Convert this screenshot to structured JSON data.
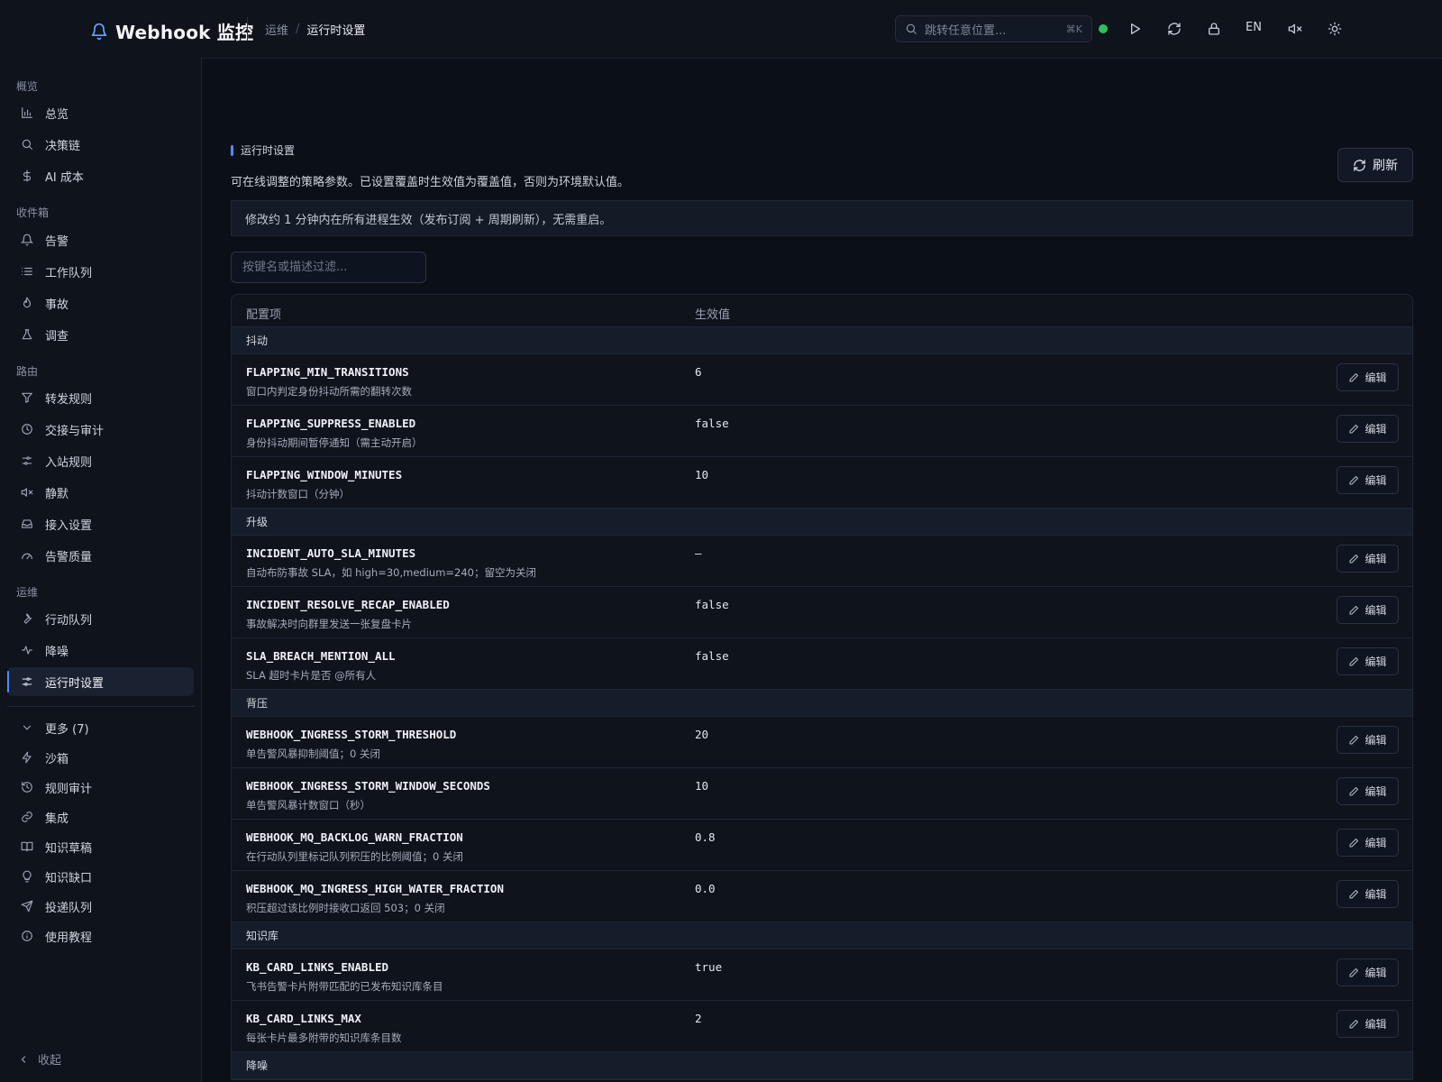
{
  "header": {
    "brand": "Webhook 监控",
    "breadcrumb_parent": "运维",
    "breadcrumb_sep": "/",
    "breadcrumb_current": "运行时设置",
    "search_placeholder": "跳转任意位置...",
    "search_shortcut": "⌘K",
    "lang": "EN",
    "status_color": "#2fbf5a"
  },
  "sidebar": {
    "groups": [
      "概览",
      "收件箱",
      "路由",
      "运维"
    ],
    "items": [
      {
        "label": "总览",
        "icon": "bar-chart-icon"
      },
      {
        "label": "决策链",
        "icon": "search-icon"
      },
      {
        "label": "AI 成本",
        "icon": "dollar-icon"
      },
      {
        "label": "告警",
        "icon": "bell-icon"
      },
      {
        "label": "工作队列",
        "icon": "list-icon"
      },
      {
        "label": "事故",
        "icon": "flame-icon"
      },
      {
        "label": "调查",
        "icon": "flask-icon"
      },
      {
        "label": "转发规则",
        "icon": "filter-icon"
      },
      {
        "label": "交接与审计",
        "icon": "clock-icon"
      },
      {
        "label": "入站规则",
        "icon": "sliders-icon"
      },
      {
        "label": "静默",
        "icon": "mute-icon"
      },
      {
        "label": "接入设置",
        "icon": "inbox-icon"
      },
      {
        "label": "告警质量",
        "icon": "gauge-icon"
      },
      {
        "label": "行动队列",
        "icon": "wrench-icon"
      },
      {
        "label": "降噪",
        "icon": "activity-icon"
      },
      {
        "label": "运行时设置",
        "icon": "settings-sliders-icon"
      }
    ],
    "more_label": "更多 (7)",
    "more_items": [
      {
        "label": "沙箱",
        "icon": "zap-icon"
      },
      {
        "label": "规则审计",
        "icon": "history-icon"
      },
      {
        "label": "集成",
        "icon": "link-icon"
      },
      {
        "label": "知识草稿",
        "icon": "book-icon"
      },
      {
        "label": "知识缺口",
        "icon": "lightbulb-icon"
      },
      {
        "label": "投递队列",
        "icon": "send-icon"
      },
      {
        "label": "使用教程",
        "icon": "info-icon"
      }
    ],
    "collapse_label": "收起",
    "active_color": "#4f8dff"
  },
  "page": {
    "section_label": "运行时设置",
    "description": "可在线调整的策略参数。已设置覆盖时生效值为覆盖值，否则为环境默认值。",
    "refresh_label": "刷新",
    "notice": "修改约 1 分钟内在所有进程生效（发布订阅 + 周期刷新），无需重启。",
    "filter_placeholder": "按键名或描述过滤...",
    "col_key": "配置项",
    "col_value": "生效值",
    "edit_label": "编辑"
  },
  "groups": [
    {
      "name": "抖动",
      "rows": [
        {
          "key": "FLAPPING_MIN_TRANSITIONS",
          "desc": "窗口内判定身份抖动所需的翻转次数",
          "value": "6"
        },
        {
          "key": "FLAPPING_SUPPRESS_ENABLED",
          "desc": "身份抖动期间暂停通知（需主动开启）",
          "value": "false"
        },
        {
          "key": "FLAPPING_WINDOW_MINUTES",
          "desc": "抖动计数窗口（分钟）",
          "value": "10"
        }
      ]
    },
    {
      "name": "升级",
      "rows": [
        {
          "key": "INCIDENT_AUTO_SLA_MINUTES",
          "desc": "自动布防事故 SLA，如 high=30,medium=240；留空为关闭",
          "value": "—"
        },
        {
          "key": "INCIDENT_RESOLVE_RECAP_ENABLED",
          "desc": "事故解决时向群里发送一张复盘卡片",
          "value": "false"
        },
        {
          "key": "SLA_BREACH_MENTION_ALL",
          "desc": "SLA 超时卡片是否 @所有人",
          "value": "false"
        }
      ]
    },
    {
      "name": "背压",
      "rows": [
        {
          "key": "WEBHOOK_INGRESS_STORM_THRESHOLD",
          "desc": "单告警风暴抑制阈值；0 关闭",
          "value": "20"
        },
        {
          "key": "WEBHOOK_INGRESS_STORM_WINDOW_SECONDS",
          "desc": "单告警风暴计数窗口（秒）",
          "value": "10"
        },
        {
          "key": "WEBHOOK_MQ_BACKLOG_WARN_FRACTION",
          "desc": "在行动队列里标记队列积压的比例阈值；0 关闭",
          "value": "0.8"
        },
        {
          "key": "WEBHOOK_MQ_INGRESS_HIGH_WATER_FRACTION",
          "desc": "积压超过该比例时接收口返回 503；0 关闭",
          "value": "0.0"
        }
      ]
    },
    {
      "name": "知识库",
      "rows": [
        {
          "key": "KB_CARD_LINKS_ENABLED",
          "desc": "飞书告警卡片附带匹配的已发布知识库条目",
          "value": "true"
        },
        {
          "key": "KB_CARD_LINKS_MAX",
          "desc": "每张卡片最多附带的知识库条目数",
          "value": "2"
        }
      ]
    },
    {
      "name": "降噪",
      "rows": []
    }
  ]
}
